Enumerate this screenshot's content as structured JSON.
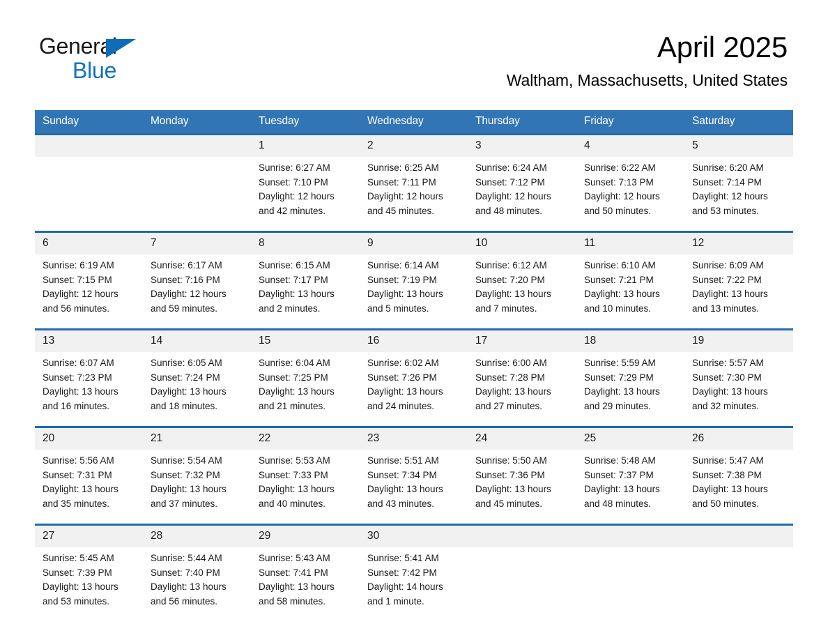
{
  "brand": {
    "name_part1": "General",
    "name_part2": "Blue",
    "triangle_color": "#0f6cb6",
    "blue_color": "#1073bd"
  },
  "header": {
    "month_title": "April 2025",
    "location": "Waltham, Massachusetts, United States"
  },
  "theme": {
    "header_blue": "#3275b4",
    "separator_blue": "#1f6cad",
    "daynum_band": "#f1f1f1"
  },
  "weekdays": [
    "Sunday",
    "Monday",
    "Tuesday",
    "Wednesday",
    "Thursday",
    "Friday",
    "Saturday"
  ],
  "weeks": [
    [
      {
        "day": "",
        "sunrise": "",
        "sunset": "",
        "daylight1": "",
        "daylight2": ""
      },
      {
        "day": "",
        "sunrise": "",
        "sunset": "",
        "daylight1": "",
        "daylight2": ""
      },
      {
        "day": "1",
        "sunrise": "Sunrise: 6:27 AM",
        "sunset": "Sunset: 7:10 PM",
        "daylight1": "Daylight: 12 hours",
        "daylight2": "and 42 minutes."
      },
      {
        "day": "2",
        "sunrise": "Sunrise: 6:25 AM",
        "sunset": "Sunset: 7:11 PM",
        "daylight1": "Daylight: 12 hours",
        "daylight2": "and 45 minutes."
      },
      {
        "day": "3",
        "sunrise": "Sunrise: 6:24 AM",
        "sunset": "Sunset: 7:12 PM",
        "daylight1": "Daylight: 12 hours",
        "daylight2": "and 48 minutes."
      },
      {
        "day": "4",
        "sunrise": "Sunrise: 6:22 AM",
        "sunset": "Sunset: 7:13 PM",
        "daylight1": "Daylight: 12 hours",
        "daylight2": "and 50 minutes."
      },
      {
        "day": "5",
        "sunrise": "Sunrise: 6:20 AM",
        "sunset": "Sunset: 7:14 PM",
        "daylight1": "Daylight: 12 hours",
        "daylight2": "and 53 minutes."
      }
    ],
    [
      {
        "day": "6",
        "sunrise": "Sunrise: 6:19 AM",
        "sunset": "Sunset: 7:15 PM",
        "daylight1": "Daylight: 12 hours",
        "daylight2": "and 56 minutes."
      },
      {
        "day": "7",
        "sunrise": "Sunrise: 6:17 AM",
        "sunset": "Sunset: 7:16 PM",
        "daylight1": "Daylight: 12 hours",
        "daylight2": "and 59 minutes."
      },
      {
        "day": "8",
        "sunrise": "Sunrise: 6:15 AM",
        "sunset": "Sunset: 7:17 PM",
        "daylight1": "Daylight: 13 hours",
        "daylight2": "and 2 minutes."
      },
      {
        "day": "9",
        "sunrise": "Sunrise: 6:14 AM",
        "sunset": "Sunset: 7:19 PM",
        "daylight1": "Daylight: 13 hours",
        "daylight2": "and 5 minutes."
      },
      {
        "day": "10",
        "sunrise": "Sunrise: 6:12 AM",
        "sunset": "Sunset: 7:20 PM",
        "daylight1": "Daylight: 13 hours",
        "daylight2": "and 7 minutes."
      },
      {
        "day": "11",
        "sunrise": "Sunrise: 6:10 AM",
        "sunset": "Sunset: 7:21 PM",
        "daylight1": "Daylight: 13 hours",
        "daylight2": "and 10 minutes."
      },
      {
        "day": "12",
        "sunrise": "Sunrise: 6:09 AM",
        "sunset": "Sunset: 7:22 PM",
        "daylight1": "Daylight: 13 hours",
        "daylight2": "and 13 minutes."
      }
    ],
    [
      {
        "day": "13",
        "sunrise": "Sunrise: 6:07 AM",
        "sunset": "Sunset: 7:23 PM",
        "daylight1": "Daylight: 13 hours",
        "daylight2": "and 16 minutes."
      },
      {
        "day": "14",
        "sunrise": "Sunrise: 6:05 AM",
        "sunset": "Sunset: 7:24 PM",
        "daylight1": "Daylight: 13 hours",
        "daylight2": "and 18 minutes."
      },
      {
        "day": "15",
        "sunrise": "Sunrise: 6:04 AM",
        "sunset": "Sunset: 7:25 PM",
        "daylight1": "Daylight: 13 hours",
        "daylight2": "and 21 minutes."
      },
      {
        "day": "16",
        "sunrise": "Sunrise: 6:02 AM",
        "sunset": "Sunset: 7:26 PM",
        "daylight1": "Daylight: 13 hours",
        "daylight2": "and 24 minutes."
      },
      {
        "day": "17",
        "sunrise": "Sunrise: 6:00 AM",
        "sunset": "Sunset: 7:28 PM",
        "daylight1": "Daylight: 13 hours",
        "daylight2": "and 27 minutes."
      },
      {
        "day": "18",
        "sunrise": "Sunrise: 5:59 AM",
        "sunset": "Sunset: 7:29 PM",
        "daylight1": "Daylight: 13 hours",
        "daylight2": "and 29 minutes."
      },
      {
        "day": "19",
        "sunrise": "Sunrise: 5:57 AM",
        "sunset": "Sunset: 7:30 PM",
        "daylight1": "Daylight: 13 hours",
        "daylight2": "and 32 minutes."
      }
    ],
    [
      {
        "day": "20",
        "sunrise": "Sunrise: 5:56 AM",
        "sunset": "Sunset: 7:31 PM",
        "daylight1": "Daylight: 13 hours",
        "daylight2": "and 35 minutes."
      },
      {
        "day": "21",
        "sunrise": "Sunrise: 5:54 AM",
        "sunset": "Sunset: 7:32 PM",
        "daylight1": "Daylight: 13 hours",
        "daylight2": "and 37 minutes."
      },
      {
        "day": "22",
        "sunrise": "Sunrise: 5:53 AM",
        "sunset": "Sunset: 7:33 PM",
        "daylight1": "Daylight: 13 hours",
        "daylight2": "and 40 minutes."
      },
      {
        "day": "23",
        "sunrise": "Sunrise: 5:51 AM",
        "sunset": "Sunset: 7:34 PM",
        "daylight1": "Daylight: 13 hours",
        "daylight2": "and 43 minutes."
      },
      {
        "day": "24",
        "sunrise": "Sunrise: 5:50 AM",
        "sunset": "Sunset: 7:36 PM",
        "daylight1": "Daylight: 13 hours",
        "daylight2": "and 45 minutes."
      },
      {
        "day": "25",
        "sunrise": "Sunrise: 5:48 AM",
        "sunset": "Sunset: 7:37 PM",
        "daylight1": "Daylight: 13 hours",
        "daylight2": "and 48 minutes."
      },
      {
        "day": "26",
        "sunrise": "Sunrise: 5:47 AM",
        "sunset": "Sunset: 7:38 PM",
        "daylight1": "Daylight: 13 hours",
        "daylight2": "and 50 minutes."
      }
    ],
    [
      {
        "day": "27",
        "sunrise": "Sunrise: 5:45 AM",
        "sunset": "Sunset: 7:39 PM",
        "daylight1": "Daylight: 13 hours",
        "daylight2": "and 53 minutes."
      },
      {
        "day": "28",
        "sunrise": "Sunrise: 5:44 AM",
        "sunset": "Sunset: 7:40 PM",
        "daylight1": "Daylight: 13 hours",
        "daylight2": "and 56 minutes."
      },
      {
        "day": "29",
        "sunrise": "Sunrise: 5:43 AM",
        "sunset": "Sunset: 7:41 PM",
        "daylight1": "Daylight: 13 hours",
        "daylight2": "and 58 minutes."
      },
      {
        "day": "30",
        "sunrise": "Sunrise: 5:41 AM",
        "sunset": "Sunset: 7:42 PM",
        "daylight1": "Daylight: 14 hours",
        "daylight2": "and 1 minute."
      },
      {
        "day": "",
        "sunrise": "",
        "sunset": "",
        "daylight1": "",
        "daylight2": ""
      },
      {
        "day": "",
        "sunrise": "",
        "sunset": "",
        "daylight1": "",
        "daylight2": ""
      },
      {
        "day": "",
        "sunrise": "",
        "sunset": "",
        "daylight1": "",
        "daylight2": ""
      }
    ]
  ]
}
